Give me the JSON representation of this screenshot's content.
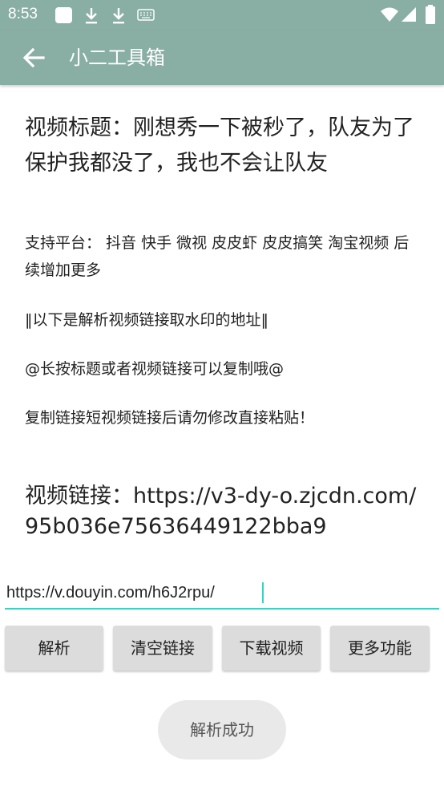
{
  "status_bar": {
    "time": "8:53",
    "icons": [
      "notification-square-icon",
      "download-icon",
      "download-icon",
      "keyboard-icon",
      "wifi-icon",
      "signal-icon",
      "battery-icon"
    ]
  },
  "app_bar": {
    "title": "小二工具箱",
    "back_icon": "arrow-left-icon",
    "color": "#89aea4"
  },
  "content": {
    "video_title": "视频标题：刚想秀一下被秒了，队友为了保护我都没了，我也不会让队友",
    "platforms": "支持平台： 抖音 快手 微视 皮皮虾 皮皮搞笑 淘宝视频 后续增加更多",
    "note_parse": "‖以下是解析视频链接取水印的地址‖",
    "note_copy": "@长按标题或者视频链接可以复制哦@",
    "note_paste": "复制链接短视频链接后请勿修改直接粘贴！",
    "video_link": "视频链接：https://v3-dy-o.zjcdn.com/95b036e75636449122bba9"
  },
  "input": {
    "value": "https://v.douyin.com/h6J2rpu/",
    "accent": "#3ccfc2"
  },
  "buttons": {
    "parse": "解析",
    "clear": "清空链接",
    "download": "下载视频",
    "more": "更多功能"
  },
  "toast": {
    "message": "解析成功"
  }
}
